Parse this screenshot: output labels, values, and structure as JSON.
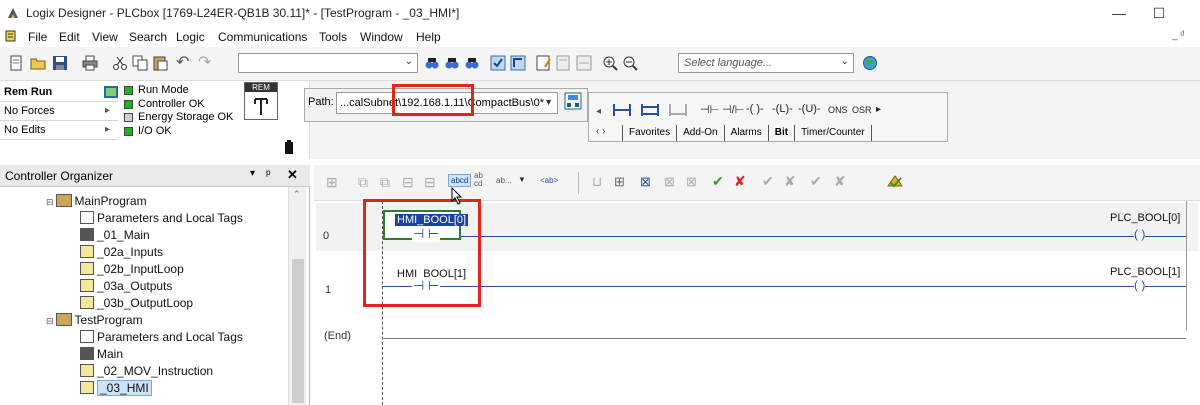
{
  "window": {
    "title": "Logix Designer - PLCbox [1769-L24ER-QB1B 30.11]* - [TestProgram - _03_HMI*]",
    "minimize": "—",
    "maximize": "☐",
    "close": "✕"
  },
  "menu": [
    "File",
    "Edit",
    "View",
    "Search",
    "Logic",
    "Communications",
    "Tools",
    "Window",
    "Help"
  ],
  "toolbar": {
    "language_placeholder": "Select language...",
    "combo_empty": ""
  },
  "status": {
    "mode": "Rem Run",
    "forces": "No Forces",
    "edits": "No Edits",
    "run_mode": "Run Mode",
    "controller_ok": "Controller OK",
    "energy_storage_ok": "Energy Storage OK",
    "io_ok": "I/O OK",
    "key_label": "REM",
    "colors": {
      "run": "#1db31d",
      "ok": "#1db31d",
      "off": "#d0d0d0"
    }
  },
  "path": {
    "label": "Path:",
    "value": "...calSubnet\\192.168.1.11\\CompactBus\\0*"
  },
  "instructions": {
    "symbols": [
      "⊣ ⊢",
      "⊣⊢",
      "⊟",
      "-] [-",
      "-]/[-",
      "-( )-",
      "-(L)-",
      "-(U)-",
      "ONS",
      "OSR"
    ],
    "tabs": [
      "Favorites",
      "Add-On",
      "Alarms",
      "Bit",
      "Timer/Counter"
    ]
  },
  "organizer": {
    "title": "Controller Organizer",
    "pin": "ᵖ",
    "close": "✕",
    "items": [
      {
        "label": "MainProgram",
        "level": 1,
        "icon": "program-folder-icon"
      },
      {
        "label": "Parameters and Local Tags",
        "level": 2,
        "icon": "tags-icon"
      },
      {
        "label": "_01_Main",
        "level": 2,
        "icon": "main-routine-icon"
      },
      {
        "label": "_02a_Inputs",
        "level": 2,
        "icon": "routine-icon"
      },
      {
        "label": "_02b_InputLoop",
        "level": 2,
        "icon": "routine-icon"
      },
      {
        "label": "_03a_Outputs",
        "level": 2,
        "icon": "routine-icon"
      },
      {
        "label": "_03b_OutputLoop",
        "level": 2,
        "icon": "routine-icon"
      },
      {
        "label": "TestProgram",
        "level": 1,
        "icon": "program-folder-icon"
      },
      {
        "label": "Parameters and Local Tags",
        "level": 2,
        "icon": "tags-icon"
      },
      {
        "label": "Main",
        "level": 2,
        "icon": "main-routine-icon"
      },
      {
        "label": "_02_MOV_Instruction",
        "level": 2,
        "icon": "routine-icon"
      },
      {
        "label": "_03_HMI",
        "level": 2,
        "icon": "routine-icon",
        "selected": true
      }
    ]
  },
  "ladder_toolbar": {
    "abcd": "abcd",
    "ab_cd": "ab cd",
    "ab_dots": "ab...",
    "ab_tag": "<ab>"
  },
  "ladder": {
    "rungs": [
      {
        "number": "0",
        "input_tag": "HMI_BOOL[0]",
        "output_tag": "PLC_BOOL[0]",
        "selected": true
      },
      {
        "number": "1",
        "input_tag": "HMI_BOOL[1]",
        "output_tag": "PLC_BOOL[1]",
        "selected": false
      }
    ],
    "end_label": "(End)"
  },
  "highlight_color": "#e0261b"
}
